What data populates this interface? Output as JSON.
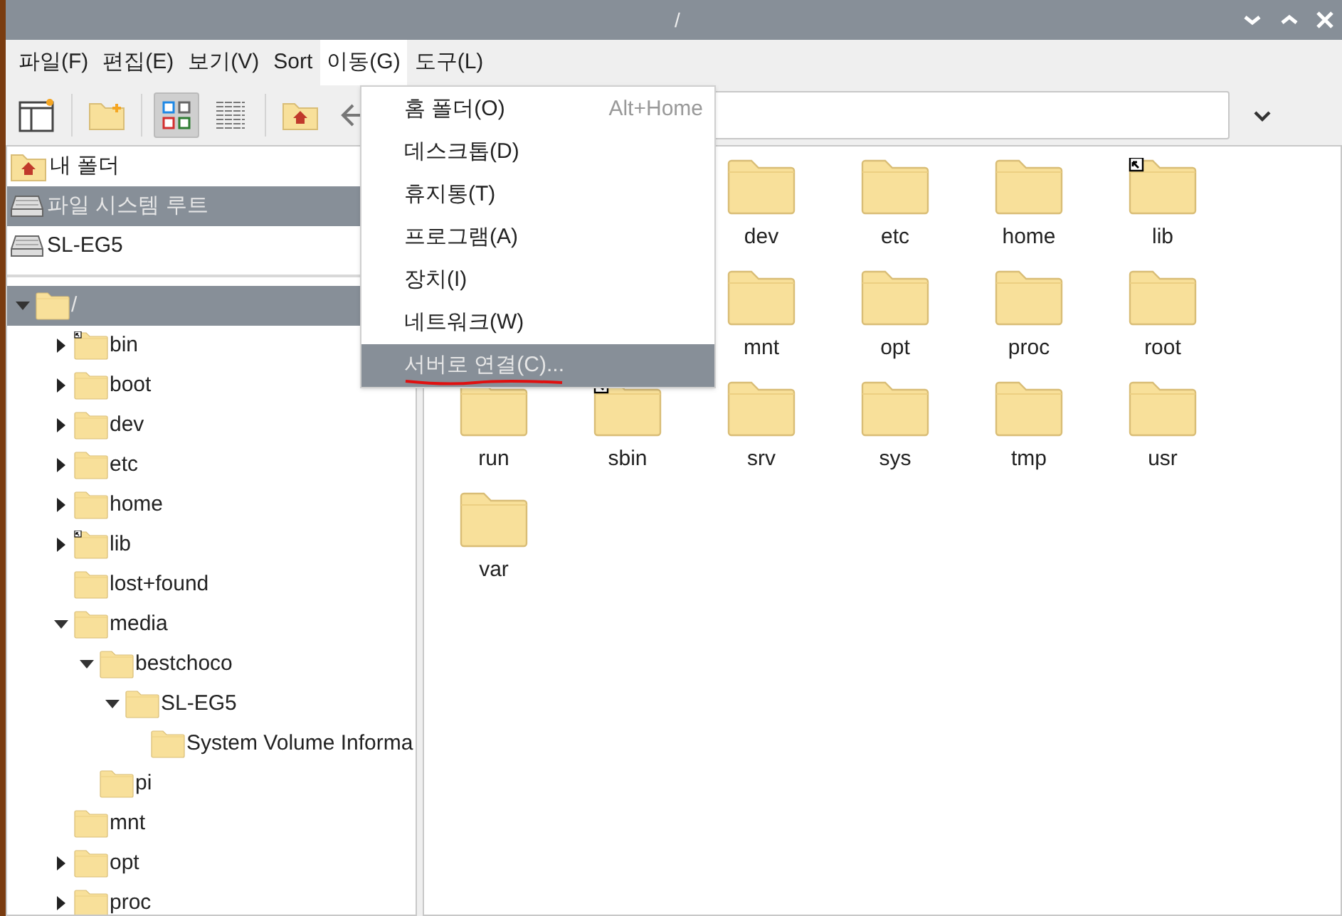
{
  "window": {
    "title": "/"
  },
  "menubar": [
    {
      "label": "파일(F)",
      "selected": false
    },
    {
      "label": "편집(E)",
      "selected": false
    },
    {
      "label": "보기(V)",
      "selected": false
    },
    {
      "label": "Sort",
      "selected": false
    },
    {
      "label": "이동(G)",
      "selected": true
    },
    {
      "label": "도구(L)",
      "selected": false
    }
  ],
  "toolbar": [
    {
      "kind": "new-window",
      "selected": false
    },
    {
      "kind": "separator"
    },
    {
      "kind": "new-folder",
      "selected": false
    },
    {
      "kind": "separator"
    },
    {
      "kind": "icon-view",
      "selected": true
    },
    {
      "kind": "list-view",
      "selected": false
    },
    {
      "kind": "separator"
    },
    {
      "kind": "home",
      "selected": false
    },
    {
      "kind": "back",
      "selected": false
    }
  ],
  "places": [
    {
      "label": "내 폴더",
      "kind": "home",
      "selected": false
    },
    {
      "label": "파일 시스템 루트",
      "kind": "drive",
      "selected": true
    },
    {
      "label": "SL-EG5",
      "kind": "drive",
      "selected": false
    }
  ],
  "tree": [
    {
      "name": "/",
      "expandable": true,
      "expanded": true,
      "selected": true,
      "children": [
        {
          "name": "bin",
          "expandable": true,
          "expanded": false,
          "selected": false,
          "link": true
        },
        {
          "name": "boot",
          "expandable": true,
          "expanded": false,
          "selected": false
        },
        {
          "name": "dev",
          "expandable": true,
          "expanded": false,
          "selected": false
        },
        {
          "name": "etc",
          "expandable": true,
          "expanded": false,
          "selected": false
        },
        {
          "name": "home",
          "expandable": true,
          "expanded": false,
          "selected": false
        },
        {
          "name": "lib",
          "expandable": true,
          "expanded": false,
          "selected": false,
          "link": true
        },
        {
          "name": "lost+found",
          "expandable": false,
          "selected": false
        },
        {
          "name": "media",
          "expandable": true,
          "expanded": true,
          "selected": false,
          "children": [
            {
              "name": "bestchoco",
              "expandable": true,
              "expanded": true,
              "selected": false,
              "children": [
                {
                  "name": "SL-EG5",
                  "expandable": true,
                  "expanded": true,
                  "selected": false,
                  "children": [
                    {
                      "name": "System Volume Informa",
                      "expandable": false,
                      "selected": false
                    }
                  ]
                }
              ]
            },
            {
              "name": "pi",
              "expandable": false,
              "selected": false
            }
          ]
        },
        {
          "name": "mnt",
          "expandable": false,
          "selected": false
        },
        {
          "name": "opt",
          "expandable": true,
          "expanded": false,
          "selected": false
        },
        {
          "name": "proc",
          "expandable": true,
          "expanded": false,
          "selected": false
        }
      ]
    }
  ],
  "files": [
    {
      "kind": "covered"
    },
    {
      "kind": "covered"
    },
    {
      "kind": "folder",
      "name": "dev"
    },
    {
      "kind": "folder",
      "name": "etc"
    },
    {
      "kind": "folder",
      "name": "home"
    },
    {
      "kind": "folder",
      "name": "lib",
      "link": true
    },
    {
      "kind": "covered"
    },
    {
      "kind": "covered"
    },
    {
      "kind": "folder",
      "name": "mnt"
    },
    {
      "kind": "folder",
      "name": "opt"
    },
    {
      "kind": "folder",
      "name": "proc"
    },
    {
      "kind": "folder",
      "name": "root"
    },
    {
      "kind": "folder",
      "name": "run"
    },
    {
      "kind": "folder",
      "name": "sbin",
      "link": true
    },
    {
      "kind": "folder",
      "name": "srv"
    },
    {
      "kind": "folder",
      "name": "sys"
    },
    {
      "kind": "folder",
      "name": "tmp"
    },
    {
      "kind": "folder",
      "name": "usr"
    },
    {
      "kind": "folder",
      "name": "var"
    }
  ],
  "go_menu": [
    {
      "label": "홈 폴더(O)",
      "shortcut": "Alt+Home",
      "selected": false
    },
    {
      "label": "데스크톱(D)",
      "selected": false
    },
    {
      "label": "휴지통(T)",
      "selected": false
    },
    {
      "label": "프로그램(A)",
      "selected": false
    },
    {
      "label": "장치(I)",
      "selected": false
    },
    {
      "label": "네트워크(W)",
      "selected": false
    },
    {
      "label": "서버로 연결(C)...",
      "selected": true
    }
  ]
}
